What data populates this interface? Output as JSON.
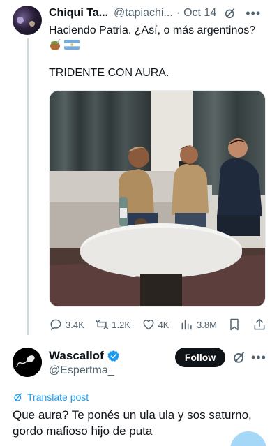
{
  "tweet": {
    "author_name": "Chiqui Ta...",
    "handle": "@tapiachi...",
    "separator": "·",
    "time": "Oct 14",
    "more": "•••",
    "text_line1": "Haciendo Patria. ¿Así, o más argentinos?",
    "text_line2": "TRIDENTE CON AURA.",
    "icons": [
      "mate-icon",
      "argentina-flag-icon",
      "grok-icon",
      "more-icon"
    ]
  },
  "actions": {
    "replies": "3.4K",
    "reposts": "1.2K",
    "likes": "4K",
    "views": "3.8M"
  },
  "reply": {
    "author_name": "Wascallof",
    "handle": "@Espertma_",
    "follow_label": "Follow",
    "more": "•••",
    "translate_label": "Translate post",
    "text": "Que aura? Te ponés un ula ula y sos saturno, gordo mafioso hijo de puta"
  },
  "colors": {
    "accent": "#1d9bf0",
    "text": "#0f1419",
    "muted": "#536471",
    "button": "#0f1419"
  }
}
